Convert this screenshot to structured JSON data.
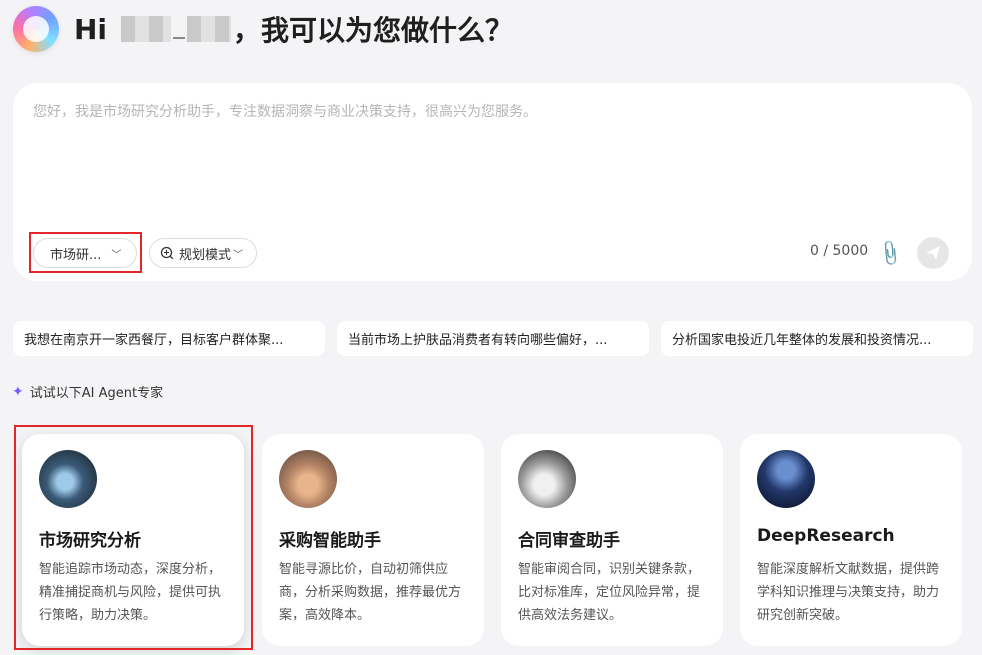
{
  "header": {
    "greeting_prefix": "Hi",
    "greeting_suffix": "，我可以为您做什么？"
  },
  "composer": {
    "placeholder": "您好，我是市场研究分析助手，专注数据洞察与商业决策支持，很高兴为您服务。",
    "agent_selector": "市场研...",
    "mode_selector": "规划模式",
    "char_counter": "0 / 5000"
  },
  "suggestions": [
    "我想在南京开一家西餐厅，目标客户群体聚...",
    "当前市场上护肤品消费者有转向哪些偏好，...",
    "分析国家电投近几年整体的发展和投资情况..."
  ],
  "agents_section": {
    "label": "试试以下AI Agent专家"
  },
  "agents": [
    {
      "title": "市场研究分析",
      "description": "智能追踪市场动态，深度分析，精准捕捉商机与风险，提供可执行策略，助力决策。"
    },
    {
      "title": "采购智能助手",
      "description": "智能寻源比价，自动初筛供应商，分析采购数据，推荐最优方案，高效降本。"
    },
    {
      "title": "合同审查助手",
      "description": "智能审阅合同，识别关键条款，比对标准库，定位风险异常，提供高效法务建议。"
    },
    {
      "title": "DeepResearch",
      "description": "智能深度解析文献数据，提供跨学科知识推理与决策支持，助力研究创新突破。"
    }
  ],
  "colors": {
    "highlight": "#e3262a",
    "accent": "#7b5cff"
  },
  "icons": [
    "app-logo-icon",
    "chevron-down-icon",
    "planning-mode-icon",
    "attachment-icon",
    "send-icon",
    "sparkle-icon"
  ]
}
